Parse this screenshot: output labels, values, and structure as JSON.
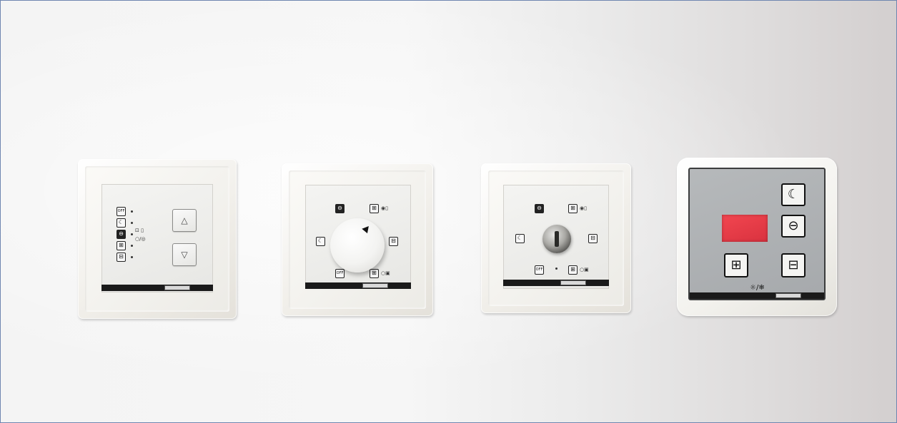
{
  "scene": {
    "background": "#f4f4f4",
    "frame_color": "#f1efea",
    "border_color": "#6f86b0",
    "display_color": "#e23a46"
  },
  "panels": [
    {
      "name": "touch-panel",
      "symbols": [
        "OFF",
        "☾",
        "⊖",
        "⊞",
        "⊟"
      ],
      "buttons": [
        "△",
        "▽"
      ]
    },
    {
      "name": "rotary-panel",
      "symbols": [
        "⊖",
        "⊞",
        "☾",
        "⊟",
        "OFF",
        "⊞"
      ]
    },
    {
      "name": "key-panel",
      "symbols": [
        "⊖",
        "⊞",
        "☾",
        "⊟",
        "OFF",
        "⊞"
      ]
    },
    {
      "name": "display-panel",
      "symbols": [
        "☾",
        "⊖",
        "⊞",
        "⊟"
      ],
      "display_color": "#e23a46"
    }
  ]
}
